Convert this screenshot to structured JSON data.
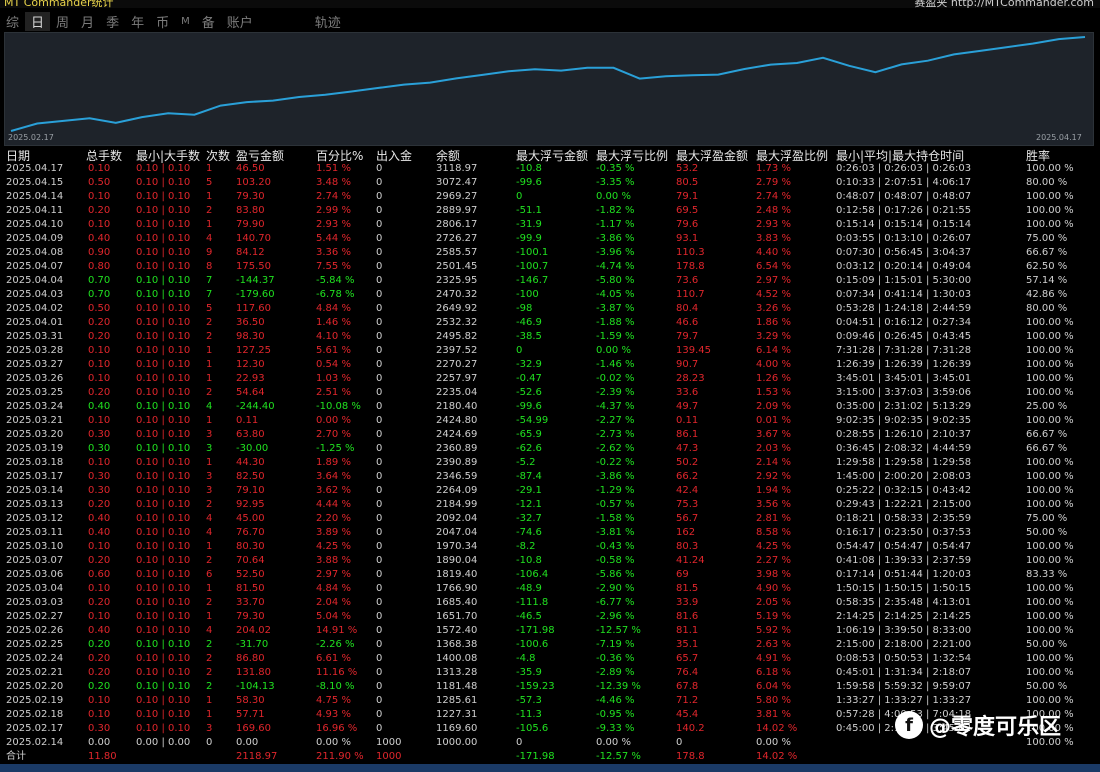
{
  "window": {
    "app_title": "MT Commander统计",
    "brand": "赛盈夹 http://MTCommander.com"
  },
  "tabs": [
    "综",
    "日",
    "周",
    "月",
    "季",
    "年",
    "币",
    "M",
    "备",
    "账户",
    "轨迹"
  ],
  "active_tab": "日",
  "chart_data": {
    "type": "line",
    "x_start": "2025.02.17",
    "x_end": "2025.04.17",
    "series": [
      {
        "values": [
          1000.0,
          1169.6,
          1227.31,
          1285.61,
          1181.48,
          1313.28,
          1400.08,
          1368.38,
          1572.4,
          1651.7,
          1685.4,
          1766.9,
          1819.4,
          1890.04,
          1970.34,
          2047.04,
          2092.04,
          2184.99,
          2264.09,
          2346.59,
          2390.89,
          2360.89,
          2424.69,
          2424.8,
          2180.4,
          2235.04,
          2257.97,
          2270.27,
          2397.52,
          2495.82,
          2532.32,
          2649.92,
          2470.32,
          2325.95,
          2501.45,
          2585.57,
          2726.27,
          2806.17,
          2889.97,
          2969.27,
          3072.47,
          3118.97
        ]
      }
    ],
    "line_color": "#2aa0d8"
  },
  "table": {
    "headers": [
      "日期",
      "总手数",
      "最小|大手数",
      "次数",
      "盈亏金额",
      "百分比%",
      "出入金",
      "余额",
      "最大浮亏金额",
      "最大浮亏比例",
      "最大浮盈金额",
      "最大浮盈比例",
      "最小|平均|最大持仓时间",
      "胜率"
    ],
    "rows": [
      {
        "t": "win",
        "c": [
          "2025.04.17",
          "0.10",
          "0.10 | 0.10",
          "1",
          "46.50",
          "1.51 %",
          "0",
          "3118.97",
          "-10.8",
          "-0.35 %",
          "53.2",
          "1.73 %",
          "0:26:03 | 0:26:03 | 0:26:03",
          "100.00 %"
        ]
      },
      {
        "t": "win",
        "c": [
          "2025.04.15",
          "0.50",
          "0.10 | 0.10",
          "5",
          "103.20",
          "3.48 %",
          "0",
          "3072.47",
          "-99.6",
          "-3.35 %",
          "80.5",
          "2.79 %",
          "0:10:33 | 2:07:51 | 4:06:17",
          "80.00 %"
        ]
      },
      {
        "t": "win",
        "c": [
          "2025.04.14",
          "0.10",
          "0.10 | 0.10",
          "1",
          "79.30",
          "2.74 %",
          "0",
          "2969.27",
          "0",
          "0.00 %",
          "79.1",
          "2.74 %",
          "0:48:07 | 0:48:07 | 0:48:07",
          "100.00 %"
        ]
      },
      {
        "t": "win",
        "c": [
          "2025.04.11",
          "0.20",
          "0.10 | 0.10",
          "2",
          "83.80",
          "2.99 %",
          "0",
          "2889.97",
          "-51.1",
          "-1.82 %",
          "69.5",
          "2.48 %",
          "0:12:58 | 0:17:26 | 0:21:55",
          "100.00 %"
        ]
      },
      {
        "t": "win",
        "c": [
          "2025.04.10",
          "0.10",
          "0.10 | 0.10",
          "1",
          "79.90",
          "2.93 %",
          "0",
          "2806.17",
          "-31.9",
          "-1.17 %",
          "79.6",
          "2.93 %",
          "0:15:14 | 0:15:14 | 0:15:14",
          "100.00 %"
        ]
      },
      {
        "t": "win",
        "c": [
          "2025.04.09",
          "0.40",
          "0.10 | 0.10",
          "4",
          "140.70",
          "5.44 %",
          "0",
          "2726.27",
          "-99.9",
          "-3.86 %",
          "93.1",
          "3.83 %",
          "0:03:55 | 0:13:10 | 0:26:07",
          "75.00 %"
        ]
      },
      {
        "t": "win",
        "c": [
          "2025.04.08",
          "0.90",
          "0.10 | 0.10",
          "9",
          "84.12",
          "3.36 %",
          "0",
          "2585.57",
          "-100.1",
          "-3.96 %",
          "110.3",
          "4.40 %",
          "0:07:30 | 0:56:45 | 3:04:37",
          "66.67 %"
        ]
      },
      {
        "t": "win",
        "c": [
          "2025.04.07",
          "0.80",
          "0.10 | 0.10",
          "8",
          "175.50",
          "7.55 %",
          "0",
          "2501.45",
          "-100.7",
          "-4.74 %",
          "178.8",
          "6.54 %",
          "0:03:12 | 0:20:14 | 0:49:04",
          "62.50 %"
        ]
      },
      {
        "t": "loss",
        "c": [
          "2025.04.04",
          "0.70",
          "0.10 | 0.10",
          "7",
          "-144.37",
          "-5.84 %",
          "0",
          "2325.95",
          "-146.7",
          "-5.80 %",
          "73.6",
          "2.97 %",
          "0:15:09 | 1:15:01 | 5:30:00",
          "57.14 %"
        ]
      },
      {
        "t": "loss",
        "c": [
          "2025.04.03",
          "0.70",
          "0.10 | 0.10",
          "7",
          "-179.60",
          "-6.78 %",
          "0",
          "2470.32",
          "-100",
          "-4.05 %",
          "110.7",
          "4.52 %",
          "0:07:34 | 0:41:14 | 1:30:03",
          "42.86 %"
        ]
      },
      {
        "t": "win",
        "c": [
          "2025.04.02",
          "0.50",
          "0.10 | 0.10",
          "5",
          "117.60",
          "4.84 %",
          "0",
          "2649.92",
          "-98",
          "-3.87 %",
          "80.4",
          "3.26 %",
          "0:53:28 | 1:24:18 | 2:44:59",
          "80.00 %"
        ]
      },
      {
        "t": "win",
        "c": [
          "2025.04.01",
          "0.20",
          "0.10 | 0.10",
          "2",
          "36.50",
          "1.46 %",
          "0",
          "2532.32",
          "-46.9",
          "-1.88 %",
          "46.6",
          "1.86 %",
          "0:04:51 | 0:16:12 | 0:27:34",
          "100.00 %"
        ]
      },
      {
        "t": "win",
        "c": [
          "2025.03.31",
          "0.20",
          "0.10 | 0.10",
          "2",
          "98.30",
          "4.10 %",
          "0",
          "2495.82",
          "-38.5",
          "-1.59 %",
          "79.7",
          "3.29 %",
          "0:09:46 | 0:26:45 | 0:43:45",
          "100.00 %"
        ]
      },
      {
        "t": "win",
        "c": [
          "2025.03.28",
          "0.10",
          "0.10 | 0.10",
          "1",
          "127.25",
          "5.61 %",
          "0",
          "2397.52",
          "0",
          "0.00 %",
          "139.45",
          "6.14 %",
          "7:31:28 | 7:31:28 | 7:31:28",
          "100.00 %"
        ]
      },
      {
        "t": "win",
        "c": [
          "2025.03.27",
          "0.10",
          "0.10 | 0.10",
          "1",
          "12.30",
          "0.54 %",
          "0",
          "2270.27",
          "-32.9",
          "-1.46 %",
          "90.7",
          "4.00 %",
          "1:26:39 | 1:26:39 | 1:26:39",
          "100.00 %"
        ]
      },
      {
        "t": "win",
        "c": [
          "2025.03.26",
          "0.10",
          "0.10 | 0.10",
          "1",
          "22.93",
          "1.03 %",
          "0",
          "2257.97",
          "-0.47",
          "-0.02 %",
          "28.23",
          "1.26 %",
          "3:45:01 | 3:45:01 | 3:45:01",
          "100.00 %"
        ]
      },
      {
        "t": "win",
        "c": [
          "2025.03.25",
          "0.20",
          "0.10 | 0.10",
          "2",
          "54.64",
          "2.51 %",
          "0",
          "2235.04",
          "-52.6",
          "-2.39 %",
          "33.6",
          "1.53 %",
          "3:15:00 | 3:37:03 | 3:59:06",
          "100.00 %"
        ]
      },
      {
        "t": "loss",
        "c": [
          "2025.03.24",
          "0.40",
          "0.10 | 0.10",
          "4",
          "-244.40",
          "-10.08 %",
          "0",
          "2180.40",
          "-99.6",
          "-4.37 %",
          "49.7",
          "2.09 %",
          "0:35:00 | 2:31:02 | 5:13:29",
          "25.00 %"
        ]
      },
      {
        "t": "win",
        "c": [
          "2025.03.21",
          "0.10",
          "0.10 | 0.10",
          "1",
          "0.11",
          "0.00 %",
          "0",
          "2424.80",
          "-54.99",
          "-2.27 %",
          "0.11",
          "0.01 %",
          "9:02:35 | 9:02:35 | 9:02:35",
          "100.00 %"
        ]
      },
      {
        "t": "win",
        "c": [
          "2025.03.20",
          "0.30",
          "0.10 | 0.10",
          "3",
          "63.80",
          "2.70 %",
          "0",
          "2424.69",
          "-65.9",
          "-2.73 %",
          "86.1",
          "3.67 %",
          "0:28:55 | 1:26:10 | 2:10:37",
          "66.67 %"
        ]
      },
      {
        "t": "loss",
        "c": [
          "2025.03.19",
          "0.30",
          "0.10 | 0.10",
          "3",
          "-30.00",
          "-1.25 %",
          "0",
          "2360.89",
          "-62.6",
          "-2.62 %",
          "47.3",
          "2.03 %",
          "0:36:45 | 2:08:32 | 4:44:59",
          "66.67 %"
        ]
      },
      {
        "t": "win",
        "c": [
          "2025.03.18",
          "0.10",
          "0.10 | 0.10",
          "1",
          "44.30",
          "1.89 %",
          "0",
          "2390.89",
          "-5.2",
          "-0.22 %",
          "50.2",
          "2.14 %",
          "1:29:58 | 1:29:58 | 1:29:58",
          "100.00 %"
        ]
      },
      {
        "t": "win",
        "c": [
          "2025.03.17",
          "0.30",
          "0.10 | 0.10",
          "3",
          "82.50",
          "3.64 %",
          "0",
          "2346.59",
          "-87.4",
          "-3.86 %",
          "66.2",
          "2.92 %",
          "1:45:00 | 2:00:20 | 2:08:03",
          "100.00 %"
        ]
      },
      {
        "t": "win",
        "c": [
          "2025.03.14",
          "0.30",
          "0.10 | 0.10",
          "3",
          "79.10",
          "3.62 %",
          "0",
          "2264.09",
          "-29.1",
          "-1.29 %",
          "42.4",
          "1.94 %",
          "0:25:22 | 0:32:15 | 0:43:42",
          "100.00 %"
        ]
      },
      {
        "t": "win",
        "c": [
          "2025.03.13",
          "0.20",
          "0.10 | 0.10",
          "2",
          "92.95",
          "4.44 %",
          "0",
          "2184.99",
          "-12.1",
          "-0.57 %",
          "75.3",
          "3.56 %",
          "0:29:43 | 1:22:21 | 2:15:00",
          "100.00 %"
        ]
      },
      {
        "t": "win",
        "c": [
          "2025.03.12",
          "0.40",
          "0.10 | 0.10",
          "4",
          "45.00",
          "2.20 %",
          "0",
          "2092.04",
          "-32.7",
          "-1.58 %",
          "56.7",
          "2.81 %",
          "0:18:21 | 0:58:33 | 2:35:59",
          "75.00 %"
        ]
      },
      {
        "t": "win",
        "c": [
          "2025.03.11",
          "0.40",
          "0.10 | 0.10",
          "4",
          "76.70",
          "3.89 %",
          "0",
          "2047.04",
          "-74.6",
          "-3.81 %",
          "162",
          "8.58 %",
          "0:16:17 | 0:23:50 | 0:37:53",
          "50.00 %"
        ]
      },
      {
        "t": "win",
        "c": [
          "2025.03.10",
          "0.10",
          "0.10 | 0.10",
          "1",
          "80.30",
          "4.25 %",
          "0",
          "1970.34",
          "-8.2",
          "-0.43 %",
          "80.3",
          "4.25 %",
          "0:54:47 | 0:54:47 | 0:54:47",
          "100.00 %"
        ]
      },
      {
        "t": "win",
        "c": [
          "2025.03.07",
          "0.20",
          "0.10 | 0.10",
          "2",
          "70.64",
          "3.88 %",
          "0",
          "1890.04",
          "-10.8",
          "-0.58 %",
          "41.24",
          "2.27 %",
          "0:41:08 | 1:39:33 | 2:37:59",
          "100.00 %"
        ]
      },
      {
        "t": "win",
        "c": [
          "2025.03.06",
          "0.60",
          "0.10 | 0.10",
          "6",
          "52.50",
          "2.97 %",
          "0",
          "1819.40",
          "-106.4",
          "-5.86 %",
          "69",
          "3.98 %",
          "0:17:14 | 0:51:44 | 1:20:03",
          "83.33 %"
        ]
      },
      {
        "t": "win",
        "c": [
          "2025.03.04",
          "0.10",
          "0.10 | 0.10",
          "1",
          "81.50",
          "4.84 %",
          "0",
          "1766.90",
          "-48.9",
          "-2.90 %",
          "81.5",
          "4.90 %",
          "1:50:15 | 1:50:15 | 1:50:15",
          "100.00 %"
        ]
      },
      {
        "t": "win",
        "c": [
          "2025.03.03",
          "0.20",
          "0.10 | 0.10",
          "2",
          "33.70",
          "2.04 %",
          "0",
          "1685.40",
          "-111.8",
          "-6.77 %",
          "33.9",
          "2.05 %",
          "0:58:35 | 2:35:48 | 4:13:01",
          "100.00 %"
        ]
      },
      {
        "t": "win",
        "c": [
          "2025.02.27",
          "0.10",
          "0.10 | 0.10",
          "1",
          "79.30",
          "5.04 %",
          "0",
          "1651.70",
          "-46.5",
          "-2.96 %",
          "81.6",
          "5.19 %",
          "2:14:25 | 2:14:25 | 2:14:25",
          "100.00 %"
        ]
      },
      {
        "t": "win",
        "c": [
          "2025.02.26",
          "0.40",
          "0.10 | 0.10",
          "4",
          "204.02",
          "14.91 %",
          "0",
          "1572.40",
          "-171.98",
          "-12.57 %",
          "81.1",
          "5.92 %",
          "1:06:19 | 3:39:50 | 8:33:00",
          "100.00 %"
        ]
      },
      {
        "t": "loss",
        "c": [
          "2025.02.25",
          "0.20",
          "0.10 | 0.10",
          "2",
          "-31.70",
          "-2.26 %",
          "0",
          "1368.38",
          "-100.6",
          "-7.19 %",
          "35.1",
          "2.63 %",
          "2:15:00 | 2:18:00 | 2:21:00",
          "50.00 %"
        ]
      },
      {
        "t": "win",
        "c": [
          "2025.02.24",
          "0.20",
          "0.10 | 0.10",
          "2",
          "86.80",
          "6.61 %",
          "0",
          "1400.08",
          "-4.8",
          "-0.36 %",
          "65.7",
          "4.91 %",
          "0:08:53 | 0:50:53 | 1:32:54",
          "100.00 %"
        ]
      },
      {
        "t": "win",
        "c": [
          "2025.02.21",
          "0.20",
          "0.10 | 0.10",
          "2",
          "131.80",
          "11.16 %",
          "0",
          "1313.28",
          "-35.9",
          "-2.89 %",
          "76.4",
          "6.18 %",
          "0:45:01 | 1:31:34 | 2:18:07",
          "100.00 %"
        ]
      },
      {
        "t": "loss",
        "c": [
          "2025.02.20",
          "0.20",
          "0.10 | 0.10",
          "2",
          "-104.13",
          "-8.10 %",
          "0",
          "1181.48",
          "-159.23",
          "-12.39 %",
          "67.8",
          "6.04 %",
          "1:59:58 | 5:59:32 | 9:59:07",
          "50.00 %"
        ]
      },
      {
        "t": "win",
        "c": [
          "2025.02.19",
          "0.10",
          "0.10 | 0.10",
          "1",
          "58.30",
          "4.75 %",
          "0",
          "1285.61",
          "-57.3",
          "-4.46 %",
          "71.2",
          "5.80 %",
          "1:33:27 | 1:33:27 | 1:33:27",
          "100.00 %"
        ]
      },
      {
        "t": "win",
        "c": [
          "2025.02.18",
          "0.10",
          "0.10 | 0.10",
          "1",
          "57.71",
          "4.93 %",
          "0",
          "1227.31",
          "-11.3",
          "-0.95 %",
          "45.4",
          "3.81 %",
          "0:57:28 | 4:00:53 | 7:04:18",
          "100.00 %"
        ]
      },
      {
        "t": "win",
        "c": [
          "2025.02.17",
          "0.30",
          "0.10 | 0.10",
          "3",
          "169.60",
          "16.96 %",
          "0",
          "1169.60",
          "-105.6",
          "-9.33 %",
          "140.2",
          "14.02 %",
          "0:45:00 | 2:13:31 | 3:45:02",
          "100.00 %"
        ]
      },
      {
        "t": "flat",
        "c": [
          "2025.02.14",
          "0.00",
          "0.00 | 0.00",
          "0",
          "0.00",
          "0.00 %",
          "1000",
          "1000.00",
          "0",
          "0.00 %",
          "0",
          "0.00 %",
          "",
          "100.00 %"
        ]
      }
    ],
    "total": {
      "label": "合计",
      "lots": "11.80",
      "pnl": "2118.97",
      "pct": "211.90 %",
      "io": "1000",
      "mdd": "-171.98",
      "mddp": "-12.57 %",
      "mfp": "178.8",
      "mfpp": "14.02 %"
    }
  },
  "watermark": {
    "logo": "f",
    "text": "@零度可乐区"
  }
}
